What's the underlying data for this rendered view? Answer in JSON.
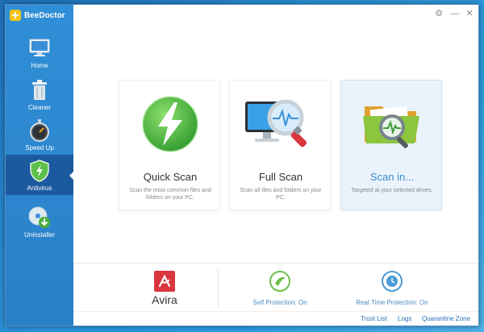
{
  "app": {
    "name": "BeeDoctor"
  },
  "sidebar": {
    "items": [
      {
        "label": "Home",
        "icon": "monitor-icon"
      },
      {
        "label": "Cleaner",
        "icon": "trash-icon"
      },
      {
        "label": "Speed Up",
        "icon": "stopwatch-icon"
      },
      {
        "label": "Antivirus",
        "icon": "shield-icon",
        "active": true
      },
      {
        "label": "Uninstaller",
        "icon": "uninstall-disc-icon"
      }
    ]
  },
  "window_controls": {
    "settings": "⚙",
    "minimize": "—",
    "close": "✕"
  },
  "scan_cards": [
    {
      "title": "Quick Scan",
      "description": "Scan the most common files and folders on your PC."
    },
    {
      "title": "Full Scan",
      "description": "Scan all files and folders on your PC."
    },
    {
      "title": "Scan in...",
      "description": "Targeted at your selected drives."
    }
  ],
  "engine": {
    "name": "Avira"
  },
  "protection": {
    "self": "Self Protection: On",
    "realtime": "Real Time Protection: On"
  },
  "footer": {
    "trust_list": "Trust List",
    "logs": "Logs",
    "quarantine": "Quarantine Zone"
  },
  "colors": {
    "sidebar": "#2f8fd6",
    "sidebar_active": "#1b5a9e",
    "accent_green": "#5cbf4a",
    "accent_red": "#d9363e",
    "link_blue": "#2a6fb3"
  }
}
